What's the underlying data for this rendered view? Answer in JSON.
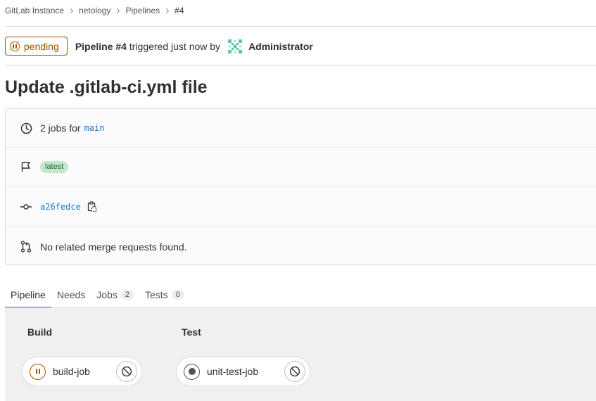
{
  "breadcrumb": [
    "GitLab Instance",
    "netology",
    "Pipelines",
    "#4"
  ],
  "header": {
    "status": "pending",
    "pipeline_label": "Pipeline #4",
    "triggered_text": "triggered just now by",
    "user": "Administrator"
  },
  "title": "Update .gitlab-ci.yml file",
  "info": {
    "jobs_text": "2 jobs for",
    "branch": "main",
    "tag_badge": "latest",
    "commit_sha": "a26fedce",
    "mr_text": "No related merge requests found."
  },
  "tabs": [
    {
      "label": "Pipeline",
      "count": null
    },
    {
      "label": "Needs",
      "count": null
    },
    {
      "label": "Jobs",
      "count": "2"
    },
    {
      "label": "Tests",
      "count": "0"
    }
  ],
  "stages": [
    {
      "name": "Build",
      "jobs": [
        {
          "name": "build-job",
          "status": "pending"
        }
      ]
    },
    {
      "name": "Test",
      "jobs": [
        {
          "name": "unit-test-job",
          "status": "created"
        }
      ]
    }
  ],
  "colors": {
    "pending": "#9e5400",
    "link": "#1f75cb",
    "tab_active": "#6666c4",
    "badge_bg": "#c3e6cd",
    "badge_text": "#24663b"
  }
}
